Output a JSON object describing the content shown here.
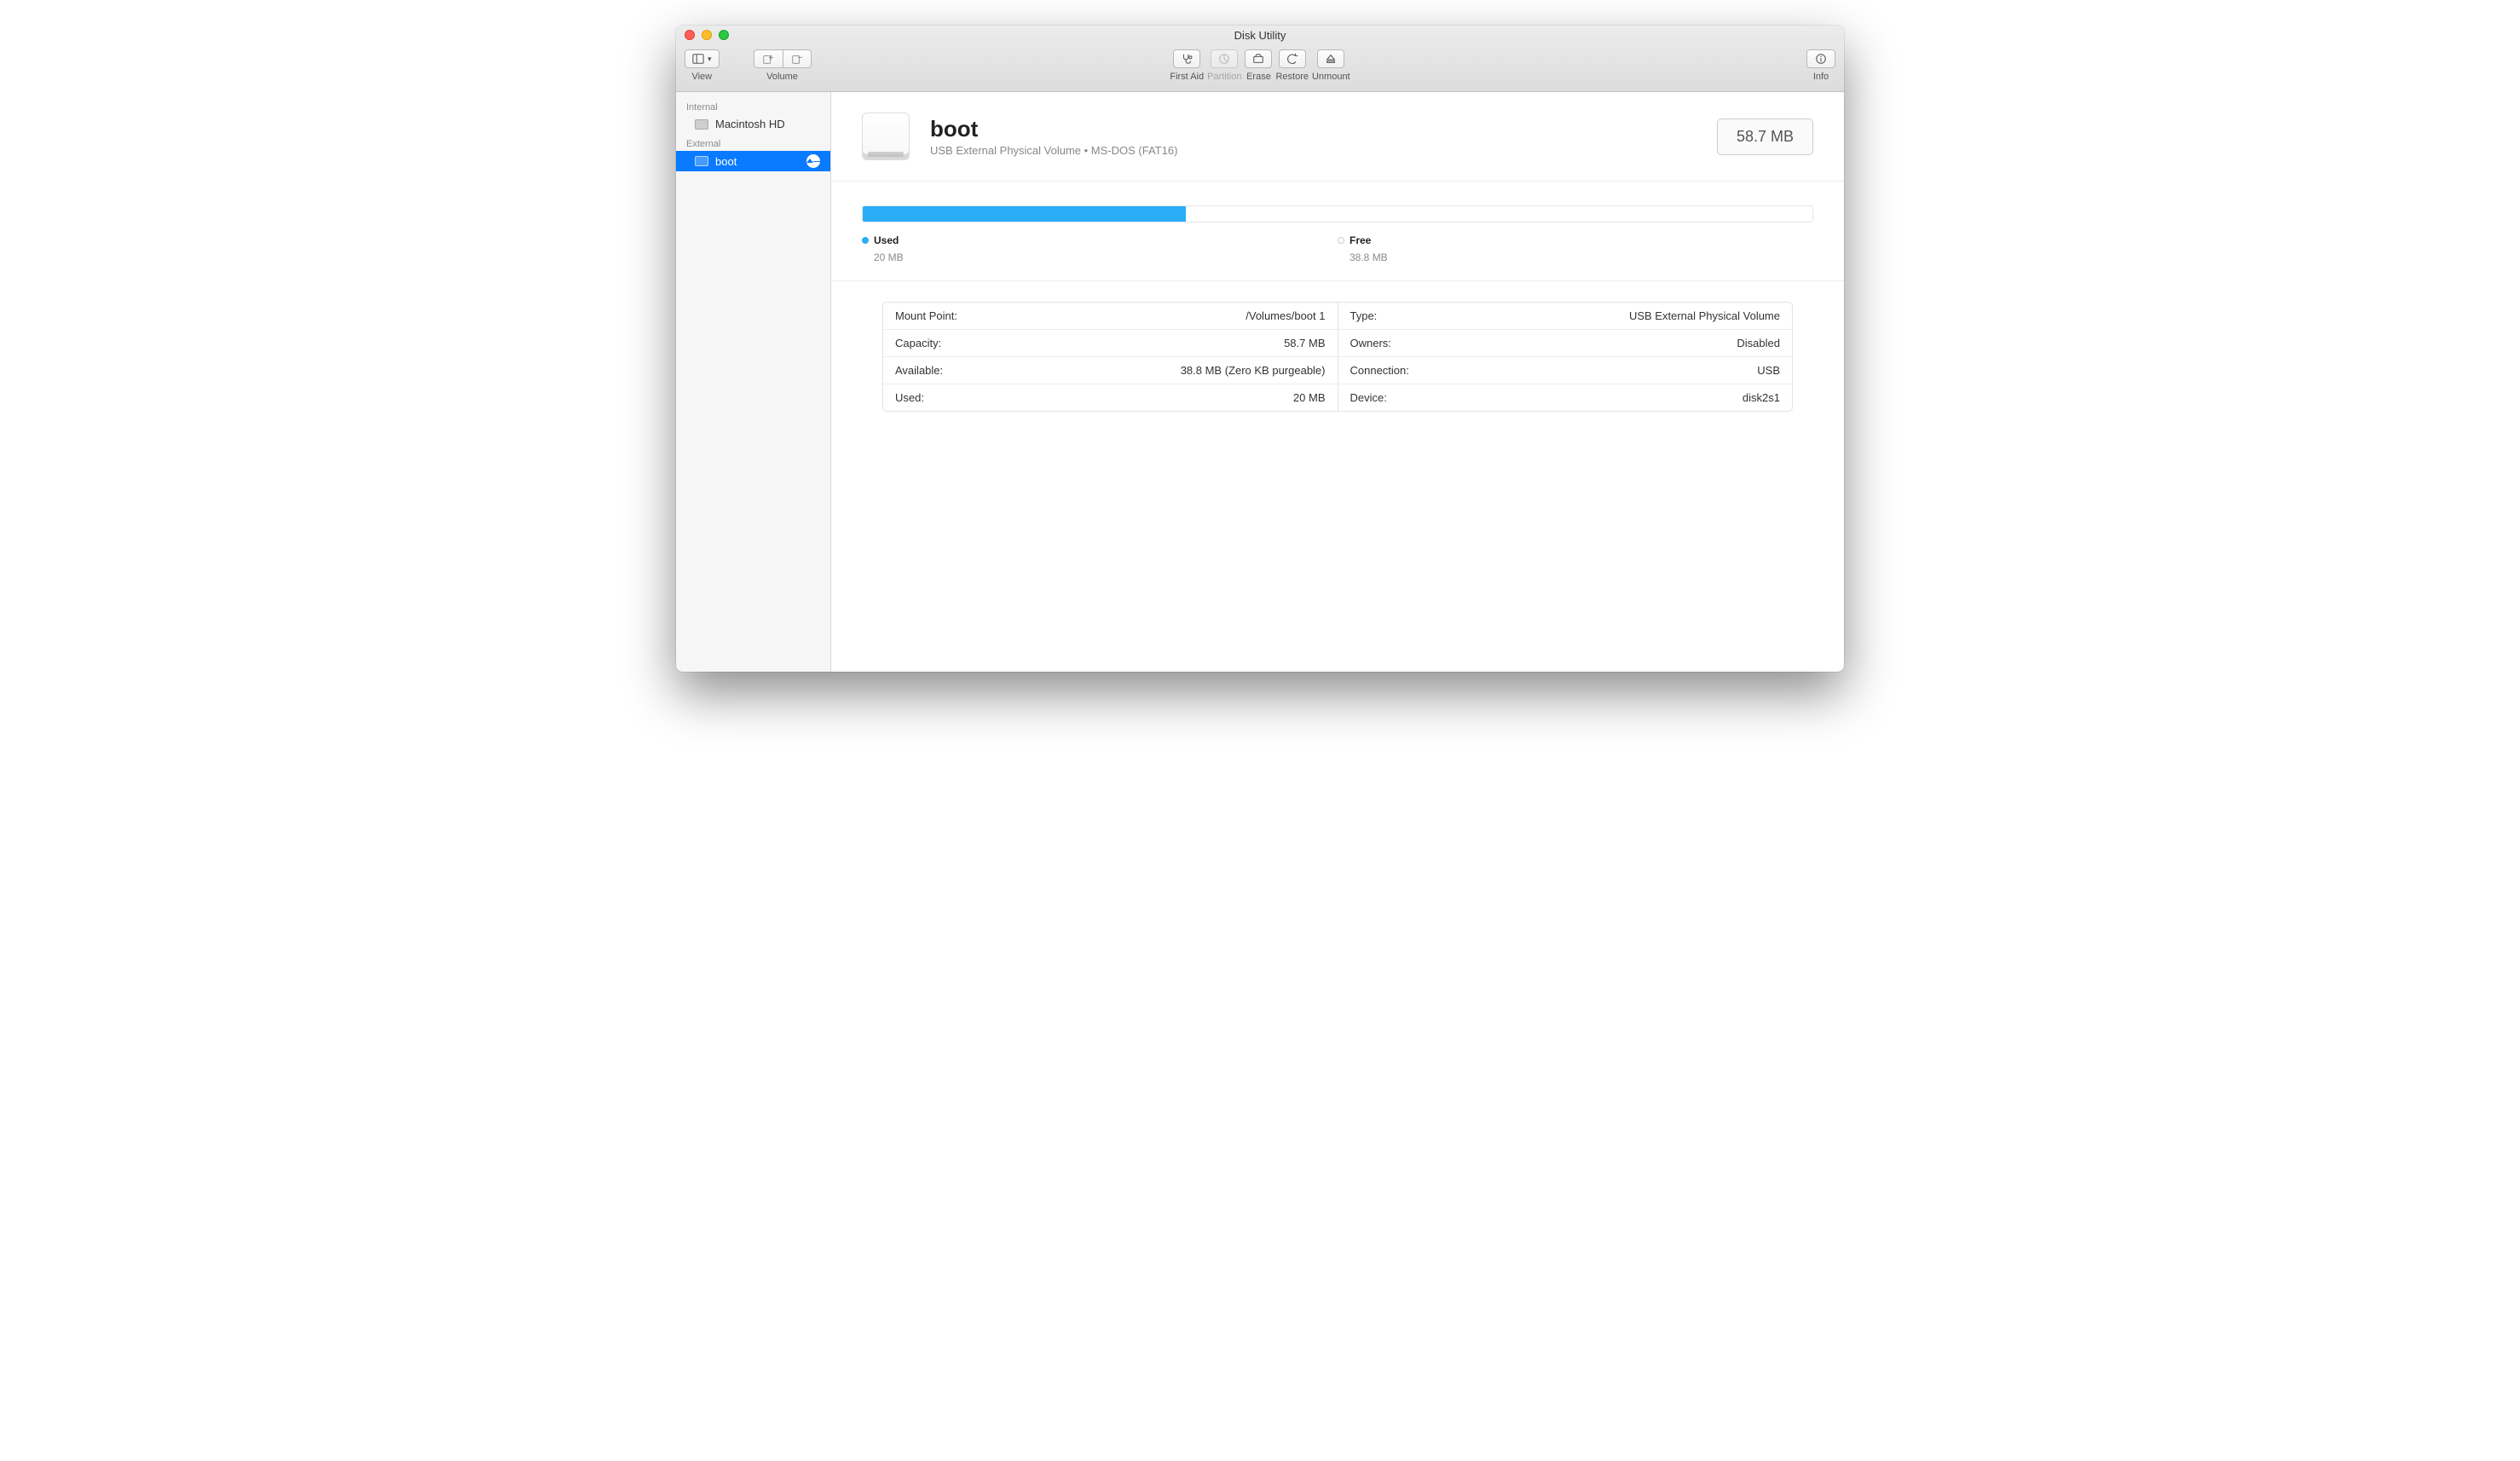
{
  "window": {
    "title": "Disk Utility"
  },
  "toolbar": {
    "view_label": "View",
    "volume_label": "Volume",
    "first_aid_label": "First Aid",
    "partition_label": "Partition",
    "erase_label": "Erase",
    "restore_label": "Restore",
    "unmount_label": "Unmount",
    "info_label": "Info"
  },
  "sidebar": {
    "internal_header": "Internal",
    "external_header": "External",
    "internal_items": [
      {
        "label": "Macintosh HD"
      }
    ],
    "external_items": [
      {
        "label": "boot"
      }
    ]
  },
  "volume": {
    "name": "boot",
    "subtitle": "USB External Physical Volume • MS-DOS (FAT16)",
    "size_badge": "58.7 MB",
    "usage": {
      "used_label": "Used",
      "used_value": "20 MB",
      "free_label": "Free",
      "free_value": "38.8 MB",
      "used_percent": 34
    },
    "details_left": [
      {
        "k": "Mount Point:",
        "v": "/Volumes/boot 1"
      },
      {
        "k": "Capacity:",
        "v": "58.7 MB"
      },
      {
        "k": "Available:",
        "v": "38.8 MB (Zero KB purgeable)"
      },
      {
        "k": "Used:",
        "v": "20 MB"
      }
    ],
    "details_right": [
      {
        "k": "Type:",
        "v": "USB External Physical Volume"
      },
      {
        "k": "Owners:",
        "v": "Disabled"
      },
      {
        "k": "Connection:",
        "v": "USB"
      },
      {
        "k": "Device:",
        "v": "disk2s1"
      }
    ]
  }
}
